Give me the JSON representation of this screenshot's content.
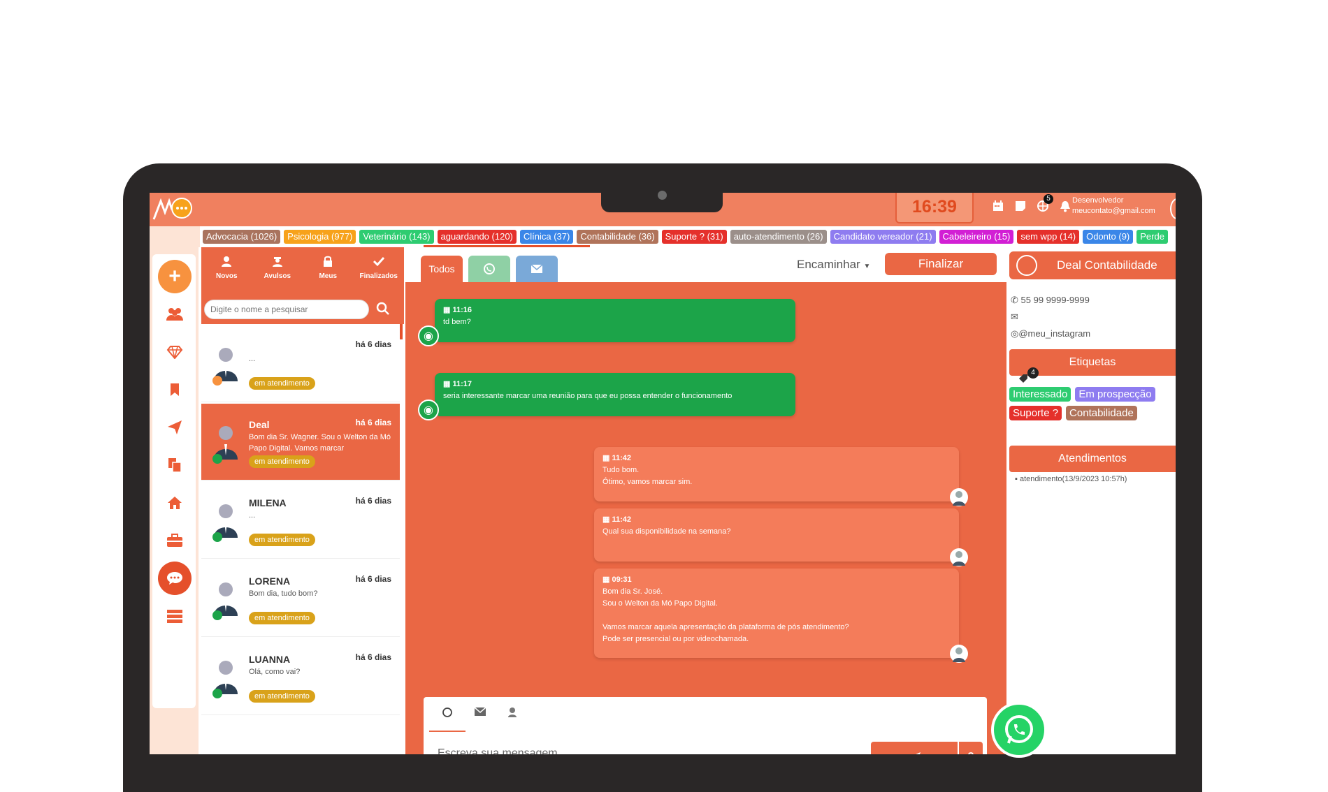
{
  "header": {
    "clock": "16:39",
    "notifications_count": "5",
    "user_role": "Desenvolvedor",
    "user_email": "meucontato@gmail.com"
  },
  "tags": [
    {
      "label": "Advocacia (1026)",
      "color": "#a9735e"
    },
    {
      "label": "Psicologia (977)",
      "color": "#f7a21b"
    },
    {
      "label": "Veterinário (143)",
      "color": "#2ecc71"
    },
    {
      "label": "aguardando (120)",
      "color": "#e5302b"
    },
    {
      "label": "Clínica (37)",
      "color": "#3a86e8"
    },
    {
      "label": "Contabilidade (36)",
      "color": "#b0735a"
    },
    {
      "label": "Suporte ? (31)",
      "color": "#e5302b"
    },
    {
      "label": "auto-atendimento (26)",
      "color": "#9b8f8a"
    },
    {
      "label": "Candidato vereador (21)",
      "color": "#8e7cf0"
    },
    {
      "label": "Cabeleireiro (15)",
      "color": "#d21fd4"
    },
    {
      "label": "sem wpp (14)",
      "color": "#e5302b"
    },
    {
      "label": "Odonto (9)",
      "color": "#3a86e8"
    },
    {
      "label": "Perde",
      "color": "#2ecc71"
    }
  ],
  "filters": [
    {
      "label": "Novos",
      "icon": "user-icon"
    },
    {
      "label": "Avulsos",
      "icon": "user-secret-icon"
    },
    {
      "label": "Meus",
      "icon": "lock-icon"
    },
    {
      "label": "Finalizados",
      "icon": "check-icon"
    }
  ],
  "search": {
    "placeholder": "Digite o nome a pesquisar"
  },
  "conversations": [
    {
      "name": "",
      "time": "há 6 dias",
      "text": "...",
      "status": "em atendimento"
    },
    {
      "name": "Deal",
      "time": "há 6 dias",
      "text": "Bom dia Sr. Wagner. Sou o Welton da Mó Papo Digital. Vamos marcar",
      "status": "em atendimento"
    },
    {
      "name": "MILENA",
      "time": "há 6 dias",
      "text": "...",
      "status": "em atendimento"
    },
    {
      "name": "LORENA",
      "time": "há 6 dias",
      "text": "Bom dia, tudo bom?",
      "status": "em atendimento"
    },
    {
      "name": "LUANNA",
      "time": "há 6 dias",
      "text": "Olá, como vai?",
      "status": "em atendimento"
    }
  ],
  "chat": {
    "tab_all": "Todos",
    "forward_label": "Encaminhar",
    "finalize_label": "Finalizar",
    "messages": [
      {
        "time": "11:16",
        "text": "td bem?",
        "direction": "in"
      },
      {
        "time": "11:17",
        "text": "seria interessante marcar uma reunião para que eu possa entender o funcionamento",
        "direction": "in"
      },
      {
        "time": "11:42",
        "line1": "Tudo bom.",
        "line2": "Ótimo, vamos marcar sim.",
        "direction": "out"
      },
      {
        "time": "11:42",
        "line1": "Qual sua disponibilidade na semana?",
        "direction": "out"
      },
      {
        "time": "09:31",
        "line1": "Bom dia Sr. José.",
        "line2": "Sou o Welton da Mó Papo Digital.",
        "line3": "Vamos marcar aquela apresentação da plataforma de pós atendimento?",
        "line4": "Pode ser presencial ou por videochamada.",
        "direction": "out"
      }
    ],
    "composer_placeholder": "Escreva sua mensagem ..."
  },
  "details": {
    "name": "Deal Contabilidade",
    "phone": "55 99 9999-9999",
    "instagram": "@meu_instagram",
    "tags_title": "Etiquetas",
    "tag_count": "4",
    "tags": [
      {
        "label": "Interessado",
        "color": "#2ecc71"
      },
      {
        "label": "Em prospecção",
        "color": "#8e7cf0"
      },
      {
        "label": "Suporte ?",
        "color": "#e5302b"
      },
      {
        "label": "Contabilidade",
        "color": "#b0735a"
      }
    ],
    "attendances_title": "Atendimentos",
    "attendance_entry": "atendimento(13/9/2023 10:57h)"
  }
}
